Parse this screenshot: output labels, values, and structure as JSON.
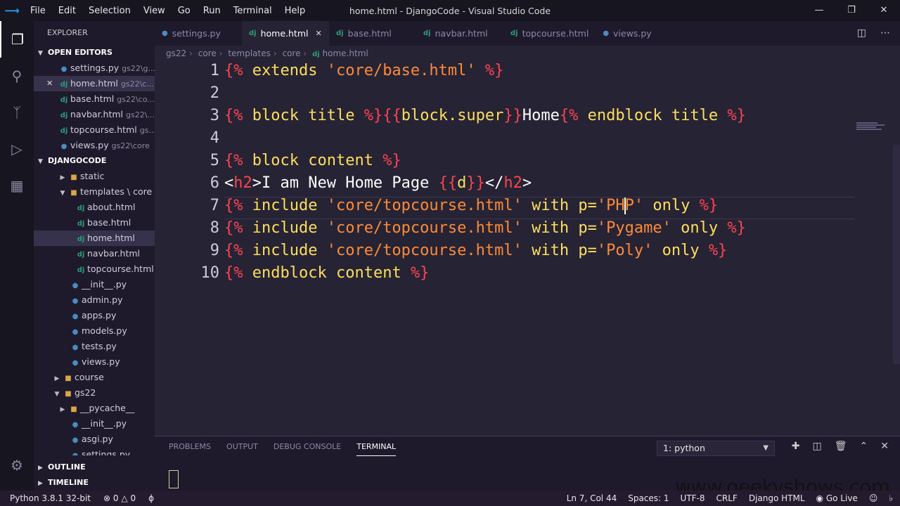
{
  "app": {
    "window_title": "home.html - DjangoCode - Visual Studio Code",
    "menu": [
      "File",
      "Edit",
      "Selection",
      "View",
      "Go",
      "Run",
      "Terminal",
      "Help"
    ]
  },
  "sidebar": {
    "title": "EXPLORER",
    "open_editors_label": "OPEN EDITORS",
    "open_editors": [
      {
        "name": "settings.py",
        "path": "gs22\\g...",
        "icon": "python-file-icon"
      },
      {
        "name": "home.html",
        "path": "gs22\\c...",
        "icon": "django-file-icon"
      },
      {
        "name": "base.html",
        "path": "gs22\\co...",
        "icon": "django-file-icon"
      },
      {
        "name": "navbar.html",
        "path": "gs22\\...",
        "icon": "django-file-icon"
      },
      {
        "name": "topcourse.html",
        "path": "gs...",
        "icon": "django-file-icon"
      },
      {
        "name": "views.py",
        "path": "gs22\\core",
        "icon": "python-file-icon"
      }
    ],
    "project_label": "DJANGOCODE",
    "tree": [
      {
        "name": "static",
        "type": "folder"
      },
      {
        "name": "templates \\ core",
        "type": "folder"
      },
      {
        "name": "about.html",
        "type": "dj"
      },
      {
        "name": "base.html",
        "type": "dj"
      },
      {
        "name": "home.html",
        "type": "dj"
      },
      {
        "name": "navbar.html",
        "type": "dj"
      },
      {
        "name": "topcourse.html",
        "type": "dj"
      },
      {
        "name": "__init__.py",
        "type": "py"
      },
      {
        "name": "admin.py",
        "type": "py"
      },
      {
        "name": "apps.py",
        "type": "py"
      },
      {
        "name": "models.py",
        "type": "py"
      },
      {
        "name": "tests.py",
        "type": "py"
      },
      {
        "name": "views.py",
        "type": "py"
      },
      {
        "name": "course",
        "type": "folder"
      },
      {
        "name": "gs22",
        "type": "folder"
      },
      {
        "name": "__pycache__",
        "type": "folder"
      },
      {
        "name": "__init__.py",
        "type": "py"
      },
      {
        "name": "asgi.py",
        "type": "py"
      },
      {
        "name": "settings.py",
        "type": "py"
      }
    ],
    "outline_label": "OUTLINE",
    "timeline_label": "TIMELINE"
  },
  "tabs": [
    {
      "label": "settings.py",
      "icon": "python-file-icon"
    },
    {
      "label": "home.html",
      "icon": "django-file-icon"
    },
    {
      "label": "base.html",
      "icon": "django-file-icon"
    },
    {
      "label": "navbar.html",
      "icon": "django-file-icon"
    },
    {
      "label": "topcourse.html",
      "icon": "django-file-icon"
    },
    {
      "label": "views.py",
      "icon": "python-file-icon"
    }
  ],
  "breadcrumb": [
    "gs22",
    "core",
    "templates",
    "core",
    "home.html"
  ],
  "editor": {
    "line_numbers": [
      "1",
      "2",
      "3",
      "4",
      "5",
      "6",
      "7",
      "8",
      "9",
      "10"
    ],
    "lines": [
      [
        [
          "tag",
          "{% "
        ],
        [
          "kw",
          "extends "
        ],
        [
          "str",
          "'core/base.html' "
        ],
        [
          "tag",
          "%}"
        ]
      ],
      [],
      [
        [
          "tag",
          "{% "
        ],
        [
          "kw",
          "block "
        ],
        [
          "kw",
          "title "
        ],
        [
          "tag",
          "%}"
        ],
        [
          "tag",
          "{{"
        ],
        [
          "kw",
          "block.super"
        ],
        [
          "tag",
          "}}"
        ],
        [
          "white",
          "Home"
        ],
        [
          "tag",
          "{% "
        ],
        [
          "kw",
          "endblock "
        ],
        [
          "kw",
          "title "
        ],
        [
          "tag",
          "%}"
        ]
      ],
      [],
      [
        [
          "tag",
          "{% "
        ],
        [
          "kw",
          "block "
        ],
        [
          "kw",
          "content "
        ],
        [
          "tag",
          "%}"
        ]
      ],
      [
        [
          "white",
          "<"
        ],
        [
          "tag",
          "h2"
        ],
        [
          "white",
          ">I am New Home Page "
        ],
        [
          "tag",
          "{{"
        ],
        [
          "kw",
          "d"
        ],
        [
          "tag",
          "}}"
        ],
        [
          "white",
          "</"
        ],
        [
          "tag",
          "h2"
        ],
        [
          "white",
          ">"
        ]
      ],
      [
        [
          "tag",
          "{% "
        ],
        [
          "kw",
          "include "
        ],
        [
          "str",
          "'core/topcourse.html' "
        ],
        [
          "kw",
          "with "
        ],
        [
          "kw",
          "p="
        ],
        [
          "str",
          "'PH"
        ],
        [
          "str",
          "P' "
        ],
        [
          "kw",
          "only "
        ],
        [
          "tag",
          "%}"
        ]
      ],
      [
        [
          "tag",
          "{% "
        ],
        [
          "kw",
          "include "
        ],
        [
          "str",
          "'core/topcourse.html' "
        ],
        [
          "kw",
          "with "
        ],
        [
          "kw",
          "p="
        ],
        [
          "str",
          "'Pygame' "
        ],
        [
          "kw",
          "only "
        ],
        [
          "tag",
          "%}"
        ]
      ],
      [
        [
          "tag",
          "{% "
        ],
        [
          "kw",
          "include "
        ],
        [
          "str",
          "'core/topcourse.html' "
        ],
        [
          "kw",
          "with "
        ],
        [
          "kw",
          "p="
        ],
        [
          "str",
          "'Poly' "
        ],
        [
          "kw",
          "only "
        ],
        [
          "tag",
          "%}"
        ]
      ],
      [
        [
          "tag",
          "{% "
        ],
        [
          "kw",
          "endblock "
        ],
        [
          "kw",
          "content "
        ],
        [
          "tag",
          "%}"
        ]
      ]
    ]
  },
  "panel": {
    "tabs": [
      "PROBLEMS",
      "OUTPUT",
      "DEBUG CONSOLE",
      "TERMINAL"
    ],
    "terminal_select": "1: python"
  },
  "statusbar": {
    "python": "Python 3.8.1 32-bit",
    "errors": "0",
    "warnings": "0",
    "position": "Ln 7, Col 44",
    "spaces": "Spaces: 1",
    "encoding": "UTF-8",
    "eol": "CRLF",
    "language": "Django HTML",
    "golive": "Go Live"
  },
  "watermark": "www.geekyshows.com"
}
